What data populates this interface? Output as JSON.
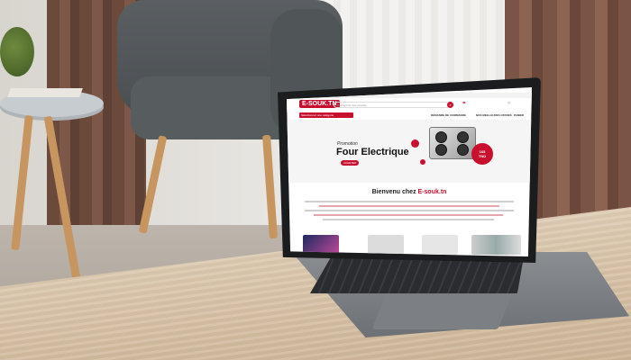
{
  "scene": {
    "description_free": true
  },
  "website": {
    "logo": "E-SOUK.TN",
    "search_placeholder": "Rechercher des produits",
    "category_button": "Sélectionnez une catégorie",
    "nav_links": [
      "DEMANDE DE COMMANDE",
      "NOS MEILLEURES OFFRES",
      "PANIER"
    ],
    "promo_label": "Promotion",
    "banner_title": "Four Electrique",
    "banner_button": "ACHETER",
    "price_value": "165",
    "price_currency": "TND",
    "welcome_prefix": "Bienvenu chez ",
    "welcome_brand": "E-souk.tn"
  },
  "colors": {
    "brand_red": "#c8102e",
    "laptop_body": "#6d7074",
    "bezel": "#1b1c1e"
  }
}
